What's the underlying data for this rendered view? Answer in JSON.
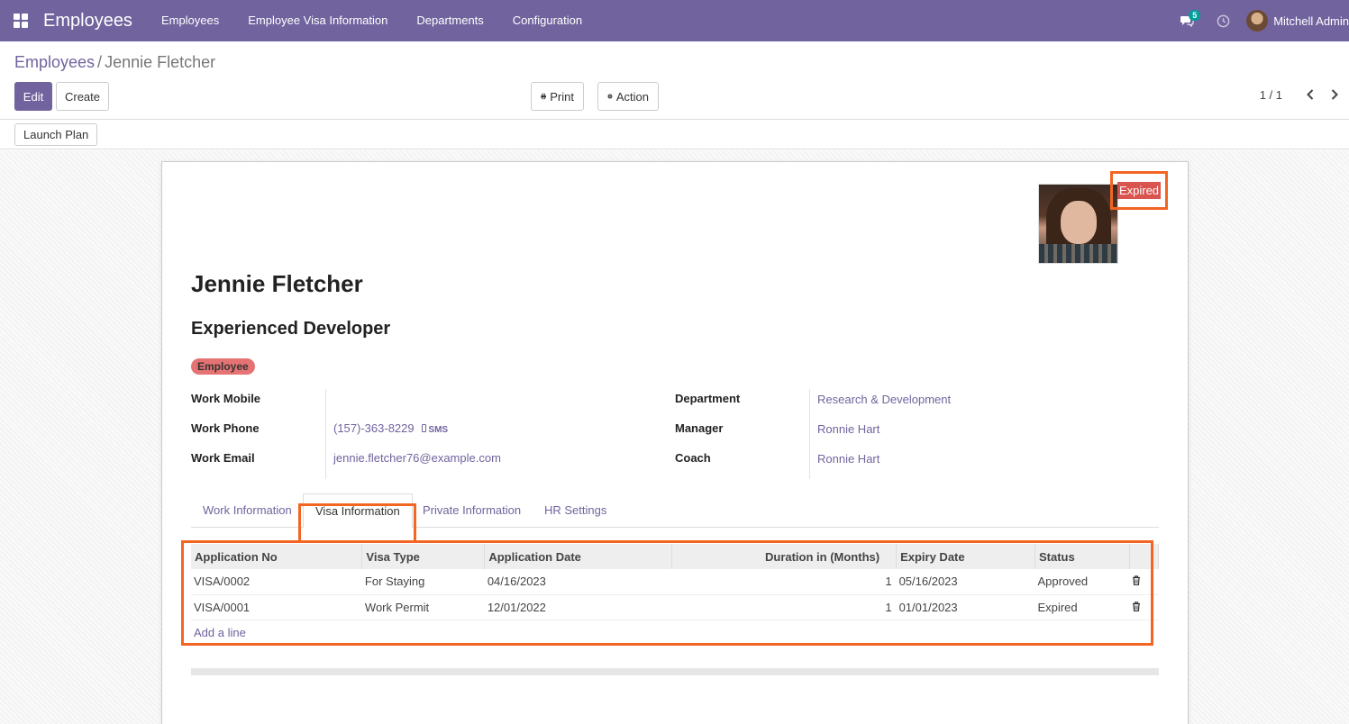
{
  "navbar": {
    "app_title": "Employees",
    "menu": [
      "Employees",
      "Employee Visa Information",
      "Departments",
      "Configuration"
    ],
    "messages_count": "5",
    "user_name": "Mitchell Admin"
  },
  "breadcrumb": {
    "parent": "Employees",
    "separator": "/",
    "current": "Jennie Fletcher"
  },
  "toolbar": {
    "edit": "Edit",
    "create": "Create",
    "print": "Print",
    "action": "Action",
    "pager": "1 / 1"
  },
  "statusbar": {
    "launch_plan": "Launch Plan"
  },
  "employee": {
    "ribbon": "Expired",
    "name": "Jennie Fletcher",
    "job_title": "Experienced Developer",
    "tag": "Employee",
    "fields_left": [
      {
        "label": "Work Mobile",
        "value": ""
      },
      {
        "label": "Work Phone",
        "value": "(157)-363-8229",
        "extra": "SMS"
      },
      {
        "label": "Work Email",
        "value": "jennie.fletcher76@example.com"
      }
    ],
    "fields_right": [
      {
        "label": "Department",
        "value": "Research & Development"
      },
      {
        "label": "Manager",
        "value": "Ronnie Hart"
      },
      {
        "label": "Coach",
        "value": "Ronnie Hart"
      }
    ]
  },
  "tabs": [
    "Work Information",
    "Visa Information",
    "Private Information",
    "HR Settings"
  ],
  "active_tab": "Visa Information",
  "visa_table": {
    "headers": [
      "Application No",
      "Visa Type",
      "Application Date",
      "Duration in (Months)",
      "Expiry Date",
      "Status"
    ],
    "rows": [
      [
        "VISA/0002",
        "For Staying",
        "04/16/2023",
        "1",
        "05/16/2023",
        "Approved"
      ],
      [
        "VISA/0001",
        "Work Permit",
        "12/01/2022",
        "1",
        "01/01/2023",
        "Expired"
      ]
    ],
    "add_line": "Add a line"
  },
  "colors": {
    "brand": "#71639e",
    "ribbon": "#d9534f",
    "highlight": "#f26522",
    "tag": "#e57373"
  }
}
